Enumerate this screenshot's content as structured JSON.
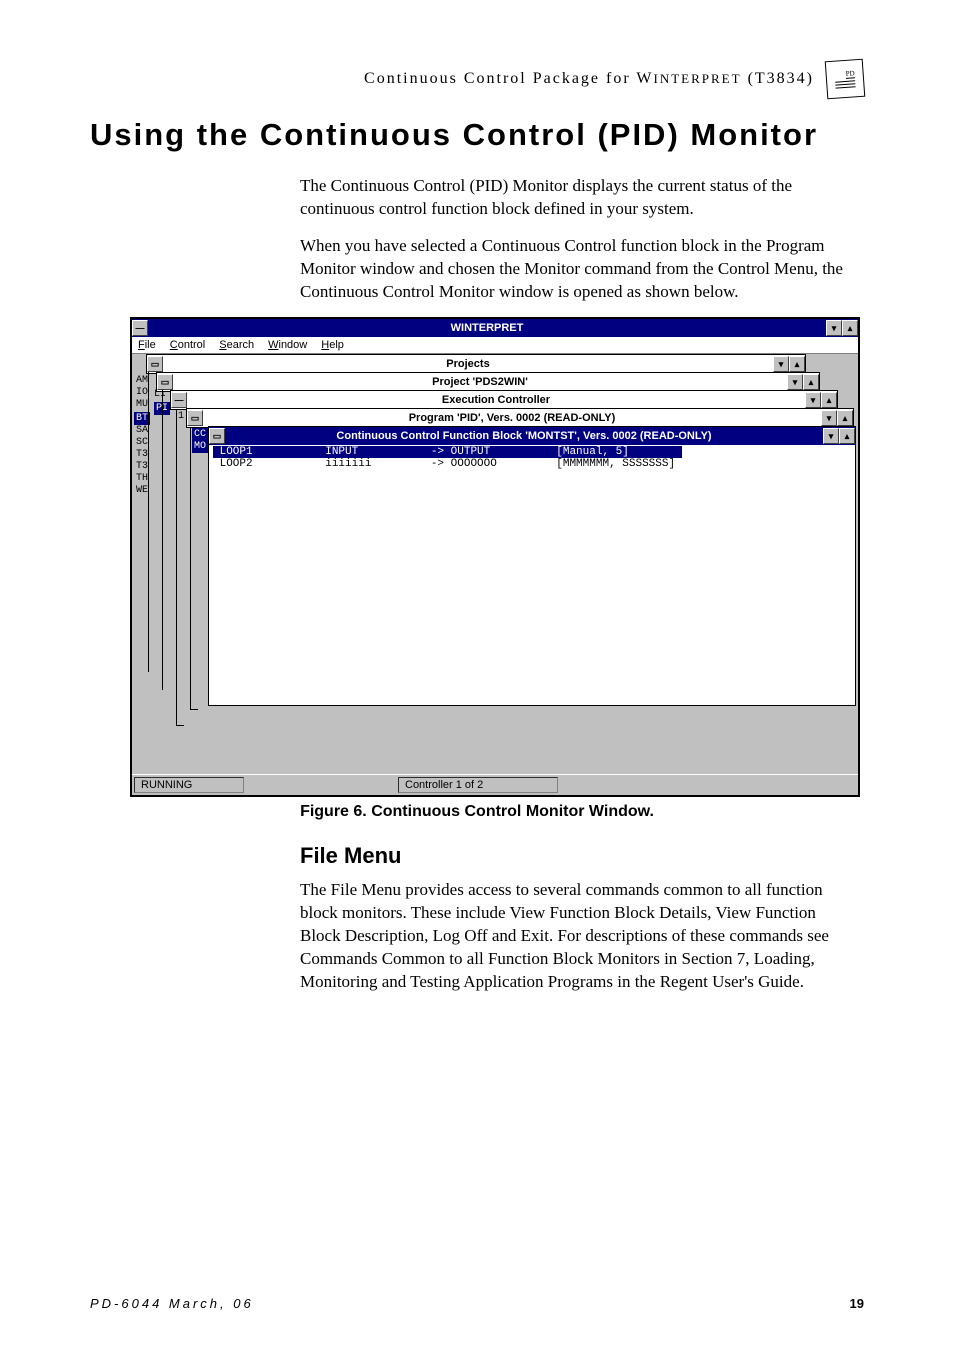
{
  "header": {
    "line": "Continuous Control Package for WINTERPRET (T3834)",
    "logo_label": "PD"
  },
  "title": "Using the Continuous Control (PID) Monitor",
  "paragraphs": {
    "p1": "The Continuous Control (PID) Monitor displays the current status of the continuous control function block defined in your system.",
    "p2": "When you have selected a Continuous Control function block in the Program Monitor window and chosen the Monitor command from the Control Menu, the Continuous Control Monitor window is opened as shown below."
  },
  "screenshot": {
    "app_title": "WINTERPRET",
    "menus": {
      "file": "File",
      "control": "Control",
      "search": "Search",
      "window": "Window",
      "help": "Help"
    },
    "windows": {
      "projects": "Projects",
      "project": "Project 'PDS2WIN'",
      "exec": "Execution Controller",
      "program": "Program 'PID', Vers. 0002 (READ-ONLY)",
      "cc": "Continuous Control Function Block 'MONTST', Vers. 0002 (READ-ONLY)"
    },
    "gutter": {
      "am": "AM",
      "io": "IO",
      "mu": "MU",
      "li": "LI",
      "pi": "PI",
      "bt": "BT",
      "sa": "SA",
      "sc": "SC",
      "t31": "T3",
      "t32": "T3",
      "th": "TH",
      "we": "WE",
      "one": "1",
      "cc_frag": "CC",
      "mo": "MO"
    },
    "cc_rows": [
      {
        "name": "LOOP1",
        "col2": "INPUT",
        "col3": "-> OUTPUT",
        "col4": "[Manual, 5]",
        "hl": true
      },
      {
        "name": "LOOP2",
        "col2": "iiiiiii",
        "col3": "-> OOOOOOO",
        "col4": "[MMMMMMM, SSSSSSS]",
        "hl": false
      }
    ],
    "status": {
      "running": "RUNNING",
      "controller": "Controller 1 of 2"
    }
  },
  "figure_caption": "Figure 6.  Continuous Control Monitor Window.",
  "section": {
    "heading": "File Menu",
    "body": "The File Menu provides access to several commands common to all function block monitors.  These include View Function Block Details, View Function Block Description, Log Off and Exit.  For descriptions of these commands see Commands Common to all Function Block Monitors in Section 7, Loading, Monitoring and Testing Application Programs in the Regent User's Guide."
  },
  "footer": {
    "left": "PD-6044 March, 06",
    "right": "19"
  }
}
